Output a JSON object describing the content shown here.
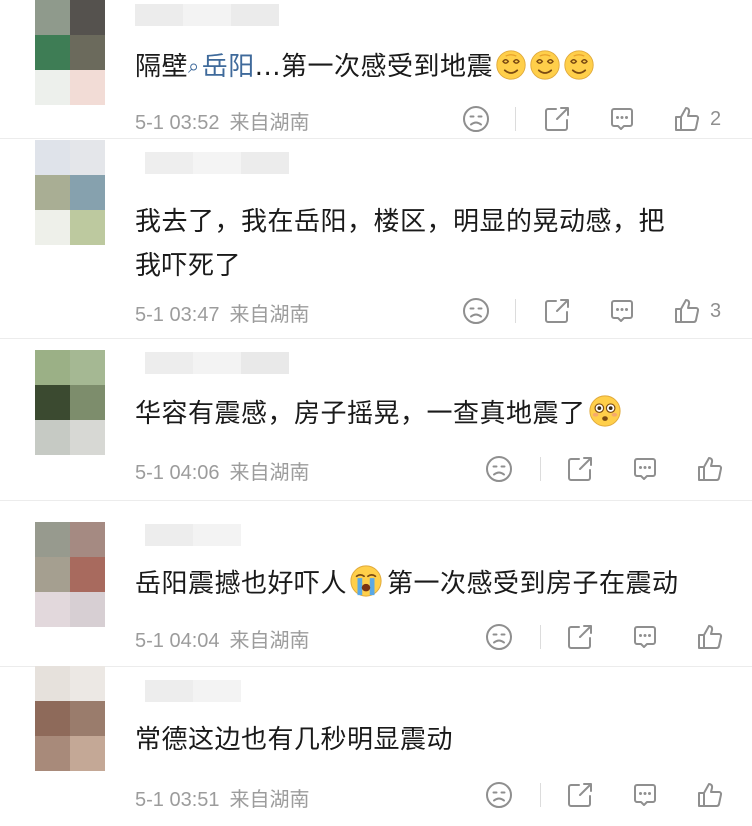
{
  "comments": [
    {
      "segments": [
        {
          "text": "隔壁",
          "type": "plain"
        },
        {
          "text": "⌕",
          "type": "icon"
        },
        {
          "text": "岳阳",
          "type": "link"
        },
        {
          "text": "...第一次感受到地震",
          "type": "plain"
        }
      ],
      "emojis": [
        "dizzy-face",
        "dizzy-face",
        "dizzy-face"
      ],
      "date": "5-1 03:52",
      "source": "来自湖南",
      "likes": "2"
    },
    {
      "lines": [
        "我去了，我在岳阳，楼区，明显的晃动感，把",
        "我吓死了"
      ],
      "date": "5-1 03:47",
      "source": "来自湖南",
      "likes": "3"
    },
    {
      "text": "华容有震感，房子摇晃，一查真地震了",
      "emojis": [
        "flushed-face"
      ],
      "date": "5-1 04:06",
      "source": "来自湖南",
      "likes": ""
    },
    {
      "text_before": "岳阳震撼也好吓人",
      "emojis": [
        "crying-face"
      ],
      "text_after": "第一次感受到房子在震动",
      "date": "5-1 04:04",
      "source": "来自湖南",
      "likes": ""
    },
    {
      "text": "常德这边也有几秒明显震动",
      "date": "5-1 03:51",
      "source": "来自湖南",
      "likes": ""
    }
  ],
  "icons": {
    "dislike": "frown-face-icon",
    "share": "share-icon",
    "reply": "comment-icon",
    "like": "thumbs-up-icon"
  },
  "colors": {
    "text": "#1a1a1a",
    "meta": "#9c9c9c",
    "link": "#3f6a9b",
    "icon": "#8f8f8f",
    "emoji": "#ffcf4a"
  }
}
